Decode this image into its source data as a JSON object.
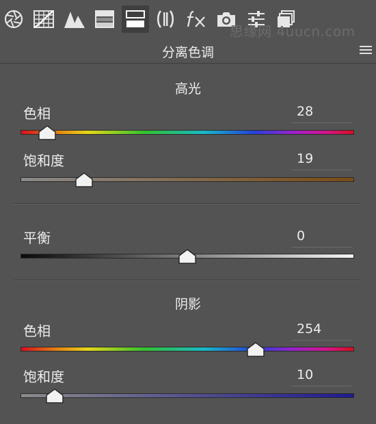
{
  "toolbar": {
    "tools": [
      {
        "icon": "aperture-icon",
        "active": false
      },
      {
        "icon": "tone-curve-grid-icon",
        "active": false
      },
      {
        "icon": "mountain-detail-icon",
        "active": false
      },
      {
        "icon": "hsl-grayscale-icon",
        "active": false
      },
      {
        "icon": "split-toning-icon",
        "active": true
      },
      {
        "icon": "lens-corrections-icon",
        "active": false
      },
      {
        "icon": "fx-effects-icon",
        "active": false
      },
      {
        "icon": "camera-calibration-icon",
        "active": false
      },
      {
        "icon": "presets-sliders-icon",
        "active": false
      },
      {
        "icon": "snapshots-icon",
        "active": false
      }
    ],
    "watermark": "思缘网 4uucn.com"
  },
  "panel": {
    "title": "分离色调",
    "menu_icon": "panel-menu-icon"
  },
  "highlights": {
    "title": "高光",
    "hue": {
      "label": "色相",
      "value": "28",
      "level": 0.078
    },
    "saturation": {
      "label": "饱和度",
      "value": "19",
      "level": 0.19,
      "color_end": "#7a4b14"
    }
  },
  "balance": {
    "label": "平衡",
    "value": "0",
    "level": 0.5
  },
  "shadows": {
    "title": "阴影",
    "hue": {
      "label": "色相",
      "value": "254",
      "level": 0.705
    },
    "saturation": {
      "label": "饱和度",
      "value": "10",
      "level": 0.1,
      "color_end": "#1f1a8e"
    }
  }
}
